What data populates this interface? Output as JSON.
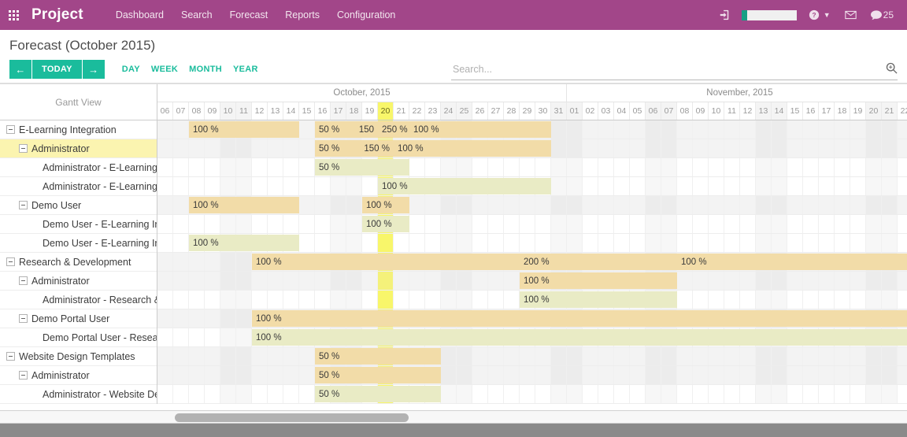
{
  "topnav": {
    "apps_icon": "apps-grid-icon",
    "brand": "Project",
    "links": [
      "Dashboard",
      "Search",
      "Forecast",
      "Reports",
      "Configuration"
    ],
    "signin_icon": "sign-in-icon",
    "help_icon": "help-icon",
    "mail_icon": "mail-icon",
    "chat_icon": "chat-icon",
    "chat_count": "25",
    "brand_color": "#a24689",
    "meter_fill_color": "#16a085"
  },
  "header": {
    "title": "Forecast (October 2015)",
    "prev_label": "←",
    "today_label": "TODAY",
    "next_label": "→",
    "scales": [
      "DAY",
      "WEEK",
      "MONTH",
      "YEAR"
    ],
    "accent_color": "#1abc9c"
  },
  "search": {
    "value": "",
    "placeholder": "Search...",
    "icon": "search-icon"
  },
  "view_toggles": [
    {
      "name": "gantt-view-toggle",
      "icon": "gantt-icon",
      "active": true
    },
    {
      "name": "list-view-toggle",
      "icon": "list-icon",
      "active": false
    },
    {
      "name": "grid-view-toggle",
      "icon": "grid-icon",
      "active": false
    }
  ],
  "gantt": {
    "left_header": "Gantt View",
    "today_day": "20",
    "months": [
      {
        "label": "October, 2015",
        "days": [
          "06",
          "07",
          "08",
          "09",
          "10",
          "11",
          "12",
          "13",
          "14",
          "15",
          "16",
          "17",
          "18",
          "19",
          "20",
          "21",
          "22",
          "23",
          "24",
          "25",
          "26",
          "27",
          "28",
          "29",
          "30",
          "31"
        ]
      },
      {
        "label": "November, 2015",
        "days": [
          "01",
          "02",
          "03",
          "04",
          "05",
          "06",
          "07",
          "08",
          "09",
          "10",
          "11",
          "12",
          "13",
          "14",
          "15",
          "16",
          "17",
          "18",
          "19",
          "20",
          "21",
          "22"
        ]
      }
    ],
    "weekend_indices": [
      4,
      5,
      11,
      12,
      18,
      19,
      25,
      26,
      31,
      32,
      38,
      39,
      45,
      46
    ],
    "rows": [
      {
        "label": "E-Learning Integration",
        "level": 0,
        "type": "summary",
        "expanded": true,
        "highlight": false,
        "bars": [
          {
            "start": 2,
            "span": 7,
            "style": "sum",
            "label": "100 %"
          },
          {
            "start": 10,
            "span": 4,
            "style": "sum",
            "label": "50 %",
            "label_right": "150"
          },
          {
            "start": 14,
            "span": 2,
            "style": "sum",
            "label": "250 %"
          },
          {
            "start": 16,
            "span": 9,
            "style": "sum",
            "label": "100 %"
          }
        ]
      },
      {
        "label": "Administrator",
        "level": 1,
        "type": "summary",
        "expanded": true,
        "highlight": true,
        "bars": [
          {
            "start": 10,
            "span": 5,
            "style": "sum",
            "label": "50 %",
            "label_right": "150 %"
          },
          {
            "start": 15,
            "span": 10,
            "style": "sum",
            "label": "100 %"
          }
        ]
      },
      {
        "label": "Administrator - E-Learning Integration",
        "level": 2,
        "type": "task",
        "expanded": false,
        "highlight": false,
        "bars": [
          {
            "start": 10,
            "span": 6,
            "style": "task",
            "label": "50 %"
          }
        ]
      },
      {
        "label": "Administrator - E-Learning Integration",
        "level": 2,
        "type": "task",
        "expanded": false,
        "highlight": false,
        "bars": [
          {
            "start": 14,
            "span": 11,
            "style": "task",
            "label": "100 %"
          }
        ]
      },
      {
        "label": "Demo User",
        "level": 1,
        "type": "summary",
        "expanded": true,
        "highlight": false,
        "bars": [
          {
            "start": 2,
            "span": 7,
            "style": "sum",
            "label": "100 %"
          },
          {
            "start": 13,
            "span": 3,
            "style": "sum",
            "label": "100 %"
          }
        ]
      },
      {
        "label": "Demo User - E-Learning Integration",
        "level": 2,
        "type": "task",
        "expanded": false,
        "highlight": false,
        "bars": [
          {
            "start": 13,
            "span": 3,
            "style": "task",
            "label": "100 %"
          }
        ]
      },
      {
        "label": "Demo User - E-Learning Integration",
        "level": 2,
        "type": "task",
        "expanded": false,
        "highlight": false,
        "bars": [
          {
            "start": 2,
            "span": 7,
            "style": "task",
            "label": "100 %"
          }
        ]
      },
      {
        "label": "Research & Development",
        "level": 0,
        "type": "summary",
        "expanded": true,
        "highlight": false,
        "bars": [
          {
            "start": 6,
            "span": 17,
            "style": "sum",
            "label": "100 %"
          },
          {
            "start": 23,
            "span": 10,
            "style": "sum",
            "label": "200 %"
          },
          {
            "start": 33,
            "span": 15,
            "style": "sum",
            "label": "100 %"
          }
        ]
      },
      {
        "label": "Administrator",
        "level": 1,
        "type": "summary",
        "expanded": true,
        "highlight": false,
        "bars": [
          {
            "start": 23,
            "span": 10,
            "style": "sum",
            "label": "100 %"
          }
        ]
      },
      {
        "label": "Administrator - Research & Development",
        "level": 2,
        "type": "task",
        "expanded": false,
        "highlight": false,
        "bars": [
          {
            "start": 23,
            "span": 10,
            "style": "task",
            "label": "100 %"
          }
        ]
      },
      {
        "label": "Demo Portal User",
        "level": 1,
        "type": "summary",
        "expanded": true,
        "highlight": false,
        "bars": [
          {
            "start": 6,
            "span": 42,
            "style": "sum",
            "label": "100 %"
          }
        ]
      },
      {
        "label": "Demo Portal User - Research & Development",
        "level": 2,
        "type": "task",
        "expanded": false,
        "highlight": false,
        "bars": [
          {
            "start": 6,
            "span": 42,
            "style": "task",
            "label": "100 %"
          }
        ]
      },
      {
        "label": "Website Design Templates",
        "level": 0,
        "type": "summary",
        "expanded": true,
        "highlight": false,
        "bars": [
          {
            "start": 10,
            "span": 8,
            "style": "sum",
            "label": "50 %"
          }
        ]
      },
      {
        "label": "Administrator",
        "level": 1,
        "type": "summary",
        "expanded": true,
        "highlight": false,
        "bars": [
          {
            "start": 10,
            "span": 8,
            "style": "sum",
            "label": "50 %"
          }
        ]
      },
      {
        "label": "Administrator - Website Design Templates",
        "level": 2,
        "type": "task",
        "expanded": false,
        "highlight": false,
        "bars": [
          {
            "start": 10,
            "span": 8,
            "style": "task",
            "label": "50 %"
          }
        ]
      }
    ]
  },
  "scrollbar": {
    "name": "horizontal-scrollbar"
  }
}
